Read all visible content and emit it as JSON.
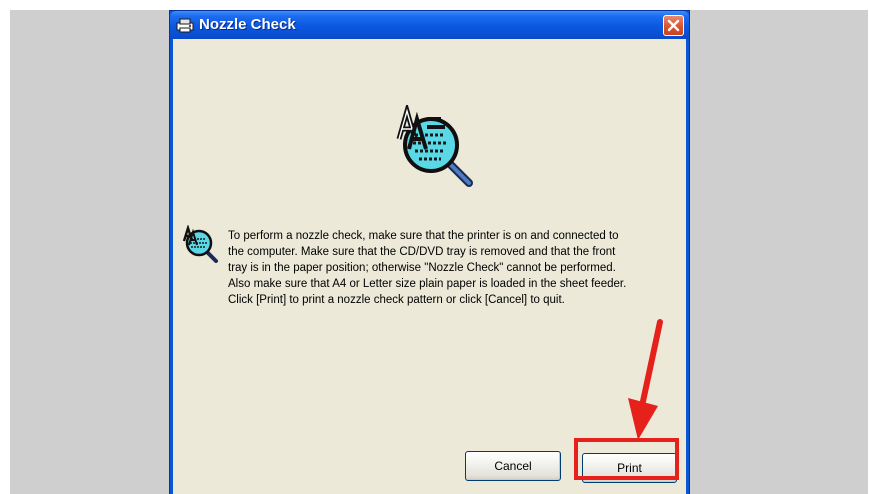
{
  "window": {
    "title": "Nozzle Check",
    "close_label": "Close"
  },
  "content": {
    "message": "To perform a nozzle check, make sure that the printer is on and connected to the computer. Make sure that the CD/DVD tray is removed and that the front tray is in the paper position; otherwise \"Nozzle Check\" cannot be performed. Also make sure that A4 or Letter size plain paper is loaded in the sheet feeder. Click [Print] to print a nozzle check pattern or click [Cancel] to quit."
  },
  "buttons": {
    "cancel_label": "Cancel",
    "print_label": "Print"
  },
  "icons": {
    "title": "printer-nozzle-icon",
    "hero": "nozzle-check-magnifier-icon",
    "message": "nozzle-check-magnifier-icon",
    "close": "close-icon"
  },
  "colors": {
    "titlebar": "#0b58e0",
    "client_bg": "#ece9d8",
    "close_button": "#d9532c",
    "annotation_red": "#e6211b",
    "magnifier_fill": "#5ad8e6"
  }
}
